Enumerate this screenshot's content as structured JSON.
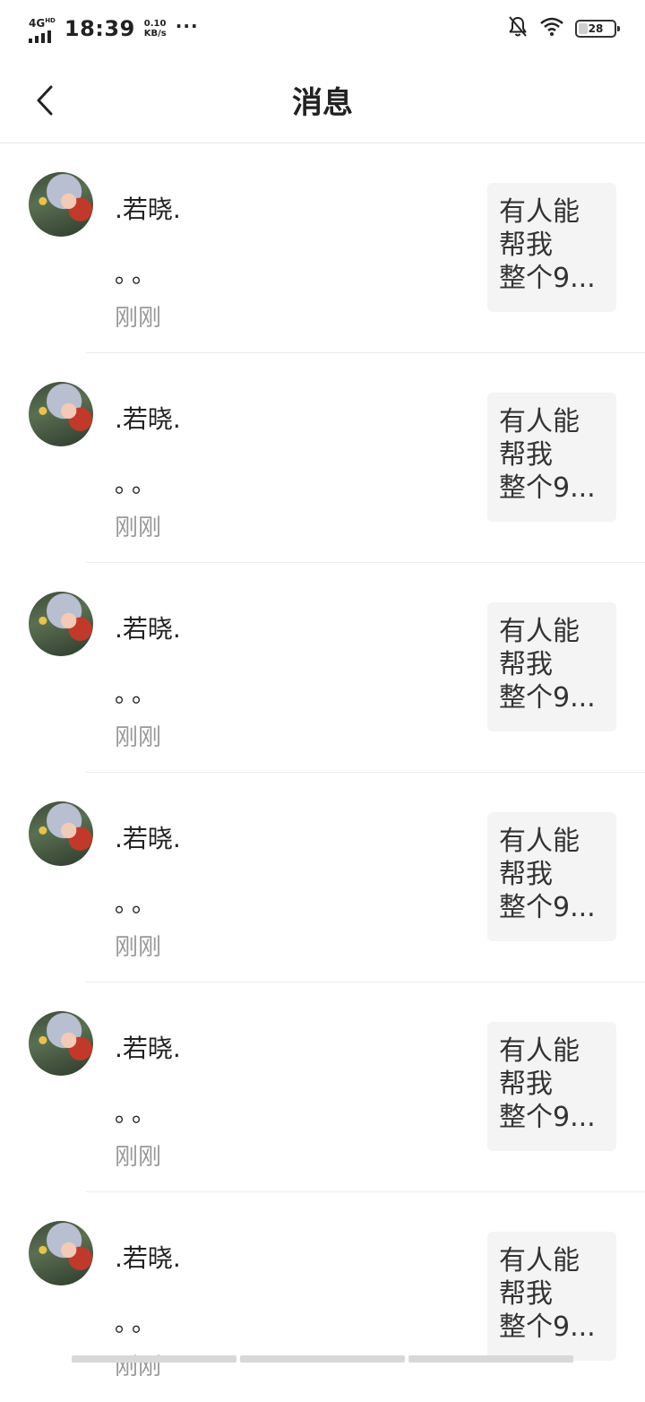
{
  "status_bar": {
    "network": "4G",
    "network_sup": "HD",
    "time": "18:39",
    "speed_value": "0.10",
    "speed_unit": "KB/s",
    "more": "···",
    "battery": "28"
  },
  "header": {
    "title": "消息"
  },
  "messages": [
    {
      "username": ".若晓.",
      "text": "。。",
      "time": "刚刚",
      "preview_lines": [
        "有人能",
        "帮我",
        "整个9..."
      ]
    },
    {
      "username": ".若晓.",
      "text": "。。",
      "time": "刚刚",
      "preview_lines": [
        "有人能",
        "帮我",
        "整个9..."
      ]
    },
    {
      "username": ".若晓.",
      "text": "。。",
      "time": "刚刚",
      "preview_lines": [
        "有人能",
        "帮我",
        "整个9..."
      ]
    },
    {
      "username": ".若晓.",
      "text": "。。",
      "time": "刚刚",
      "preview_lines": [
        "有人能",
        "帮我",
        "整个9..."
      ]
    },
    {
      "username": ".若晓.",
      "text": "。。",
      "time": "刚刚",
      "preview_lines": [
        "有人能",
        "帮我",
        "整个9..."
      ]
    },
    {
      "username": ".若晓.",
      "text": "。。",
      "time": "刚刚",
      "preview_lines": [
        "有人能",
        "帮我",
        "整个9..."
      ]
    }
  ]
}
